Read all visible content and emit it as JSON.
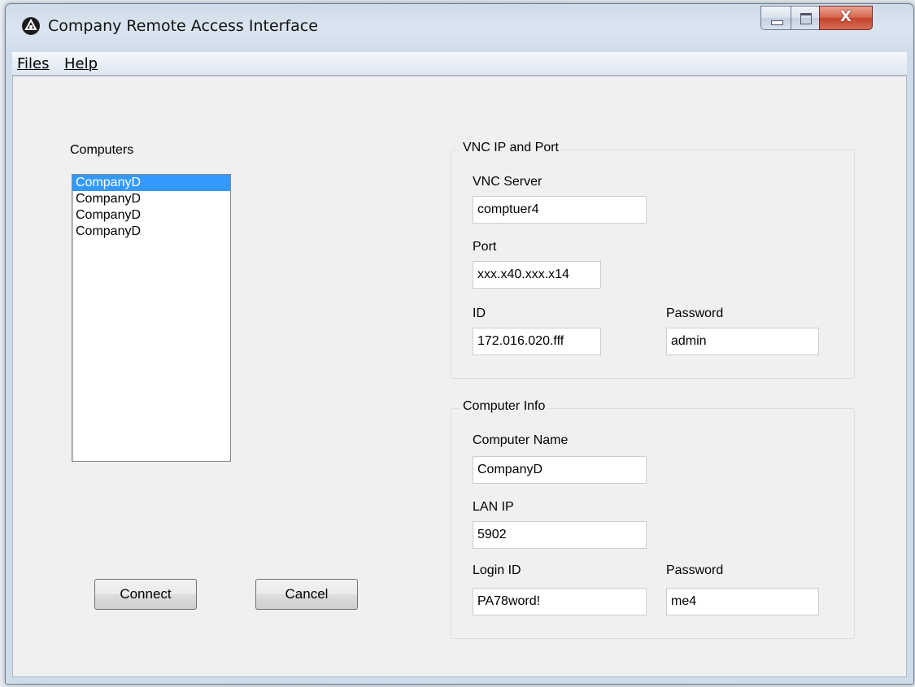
{
  "window": {
    "title": "Company Remote Access Interface"
  },
  "caption_buttons": {
    "close_glyph": "X"
  },
  "menu": {
    "files": "Files",
    "help": "Help"
  },
  "computers": {
    "label": "Computers",
    "items": [
      "CompanyD",
      "CompanyD",
      "CompanyD",
      "CompanyD"
    ],
    "selected_index": 0
  },
  "vnc_group": {
    "title": "VNC IP and Port",
    "vnc_server_label": "VNC Server",
    "vnc_server_value": "comptuer4",
    "port_label": "Port",
    "port_value": "xxx.x40.xxx.x14",
    "id_label": "ID",
    "id_value": "172.016.020.fff",
    "password_label": "Password",
    "password_value": "admin"
  },
  "info_group": {
    "title": "Computer Info",
    "computer_name_label": "Computer Name",
    "computer_name_value": "CompanyD",
    "lan_ip_label": "LAN IP",
    "lan_ip_value": "5902",
    "login_id_label": "Login ID",
    "login_id_value": "PA78word!",
    "password_label": "Password",
    "password_value": "me4"
  },
  "buttons": {
    "connect": "Connect",
    "cancel": "Cancel"
  },
  "colors": {
    "selection": "#3399ff",
    "client_bg": "#f0f0f0",
    "close_button": "#c2442b"
  }
}
